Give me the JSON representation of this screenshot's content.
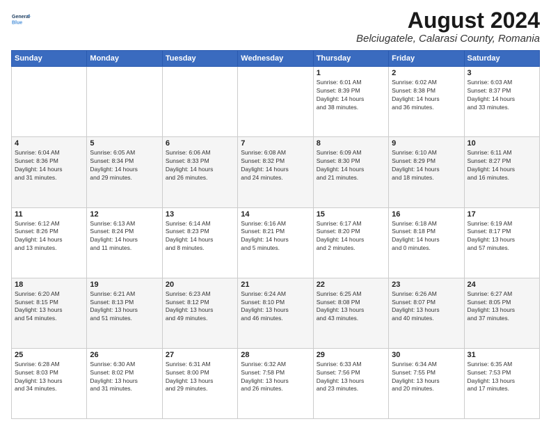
{
  "logo": {
    "line1": "General",
    "line2": "Blue"
  },
  "title": "August 2024",
  "subtitle": "Belciugatele, Calarasi County, Romania",
  "weekdays": [
    "Sunday",
    "Monday",
    "Tuesday",
    "Wednesday",
    "Thursday",
    "Friday",
    "Saturday"
  ],
  "weeks": [
    [
      {
        "day": "",
        "info": ""
      },
      {
        "day": "",
        "info": ""
      },
      {
        "day": "",
        "info": ""
      },
      {
        "day": "",
        "info": ""
      },
      {
        "day": "1",
        "info": "Sunrise: 6:01 AM\nSunset: 8:39 PM\nDaylight: 14 hours\nand 38 minutes."
      },
      {
        "day": "2",
        "info": "Sunrise: 6:02 AM\nSunset: 8:38 PM\nDaylight: 14 hours\nand 36 minutes."
      },
      {
        "day": "3",
        "info": "Sunrise: 6:03 AM\nSunset: 8:37 PM\nDaylight: 14 hours\nand 33 minutes."
      }
    ],
    [
      {
        "day": "4",
        "info": "Sunrise: 6:04 AM\nSunset: 8:36 PM\nDaylight: 14 hours\nand 31 minutes."
      },
      {
        "day": "5",
        "info": "Sunrise: 6:05 AM\nSunset: 8:34 PM\nDaylight: 14 hours\nand 29 minutes."
      },
      {
        "day": "6",
        "info": "Sunrise: 6:06 AM\nSunset: 8:33 PM\nDaylight: 14 hours\nand 26 minutes."
      },
      {
        "day": "7",
        "info": "Sunrise: 6:08 AM\nSunset: 8:32 PM\nDaylight: 14 hours\nand 24 minutes."
      },
      {
        "day": "8",
        "info": "Sunrise: 6:09 AM\nSunset: 8:30 PM\nDaylight: 14 hours\nand 21 minutes."
      },
      {
        "day": "9",
        "info": "Sunrise: 6:10 AM\nSunset: 8:29 PM\nDaylight: 14 hours\nand 18 minutes."
      },
      {
        "day": "10",
        "info": "Sunrise: 6:11 AM\nSunset: 8:27 PM\nDaylight: 14 hours\nand 16 minutes."
      }
    ],
    [
      {
        "day": "11",
        "info": "Sunrise: 6:12 AM\nSunset: 8:26 PM\nDaylight: 14 hours\nand 13 minutes."
      },
      {
        "day": "12",
        "info": "Sunrise: 6:13 AM\nSunset: 8:24 PM\nDaylight: 14 hours\nand 11 minutes."
      },
      {
        "day": "13",
        "info": "Sunrise: 6:14 AM\nSunset: 8:23 PM\nDaylight: 14 hours\nand 8 minutes."
      },
      {
        "day": "14",
        "info": "Sunrise: 6:16 AM\nSunset: 8:21 PM\nDaylight: 14 hours\nand 5 minutes."
      },
      {
        "day": "15",
        "info": "Sunrise: 6:17 AM\nSunset: 8:20 PM\nDaylight: 14 hours\nand 2 minutes."
      },
      {
        "day": "16",
        "info": "Sunrise: 6:18 AM\nSunset: 8:18 PM\nDaylight: 14 hours\nand 0 minutes."
      },
      {
        "day": "17",
        "info": "Sunrise: 6:19 AM\nSunset: 8:17 PM\nDaylight: 13 hours\nand 57 minutes."
      }
    ],
    [
      {
        "day": "18",
        "info": "Sunrise: 6:20 AM\nSunset: 8:15 PM\nDaylight: 13 hours\nand 54 minutes."
      },
      {
        "day": "19",
        "info": "Sunrise: 6:21 AM\nSunset: 8:13 PM\nDaylight: 13 hours\nand 51 minutes."
      },
      {
        "day": "20",
        "info": "Sunrise: 6:23 AM\nSunset: 8:12 PM\nDaylight: 13 hours\nand 49 minutes."
      },
      {
        "day": "21",
        "info": "Sunrise: 6:24 AM\nSunset: 8:10 PM\nDaylight: 13 hours\nand 46 minutes."
      },
      {
        "day": "22",
        "info": "Sunrise: 6:25 AM\nSunset: 8:08 PM\nDaylight: 13 hours\nand 43 minutes."
      },
      {
        "day": "23",
        "info": "Sunrise: 6:26 AM\nSunset: 8:07 PM\nDaylight: 13 hours\nand 40 minutes."
      },
      {
        "day": "24",
        "info": "Sunrise: 6:27 AM\nSunset: 8:05 PM\nDaylight: 13 hours\nand 37 minutes."
      }
    ],
    [
      {
        "day": "25",
        "info": "Sunrise: 6:28 AM\nSunset: 8:03 PM\nDaylight: 13 hours\nand 34 minutes."
      },
      {
        "day": "26",
        "info": "Sunrise: 6:30 AM\nSunset: 8:02 PM\nDaylight: 13 hours\nand 31 minutes."
      },
      {
        "day": "27",
        "info": "Sunrise: 6:31 AM\nSunset: 8:00 PM\nDaylight: 13 hours\nand 29 minutes."
      },
      {
        "day": "28",
        "info": "Sunrise: 6:32 AM\nSunset: 7:58 PM\nDaylight: 13 hours\nand 26 minutes."
      },
      {
        "day": "29",
        "info": "Sunrise: 6:33 AM\nSunset: 7:56 PM\nDaylight: 13 hours\nand 23 minutes."
      },
      {
        "day": "30",
        "info": "Sunrise: 6:34 AM\nSunset: 7:55 PM\nDaylight: 13 hours\nand 20 minutes."
      },
      {
        "day": "31",
        "info": "Sunrise: 6:35 AM\nSunset: 7:53 PM\nDaylight: 13 hours\nand 17 minutes."
      }
    ]
  ]
}
